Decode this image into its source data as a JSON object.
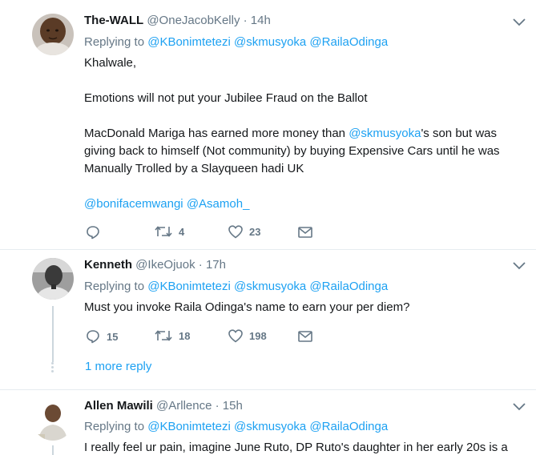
{
  "tweets": [
    {
      "name": "The-WALL",
      "handle": "@OneJacobKelly",
      "sep": "·",
      "time": "14h",
      "replying_prefix": "Replying to",
      "replying_to": [
        "@KBonimtetezi",
        "@skmusyoka",
        "@RailaOdinga"
      ],
      "lines": {
        "l1": "Khalwale,",
        "l2": "Emotions will not put your Jubilee Fraud on the Ballot",
        "l3a": "MacDonald Mariga has earned more money than ",
        "l3_mention": "@skmusyoka",
        "l3b": "'s son but was",
        "l4": "giving back to himself (Not community) by buying Expensive Cars until he was",
        "l5": "Manually Trolled by a Slayqueen hadi UK",
        "mention1": "@bonifacemwangi",
        "mention2": "@Asamoh_"
      },
      "replies": "",
      "retweets": "4",
      "likes": "23"
    },
    {
      "name": "Kenneth",
      "handle": "@IkeOjuok",
      "sep": "·",
      "time": "17h",
      "replying_prefix": "Replying to",
      "replying_to": [
        "@KBonimtetezi",
        "@skmusyoka",
        "@RailaOdinga"
      ],
      "text": "Must you invoke  Raila Odinga's name to earn your per diem?",
      "replies": "15",
      "retweets": "18",
      "likes": "198",
      "more_replies": "1 more reply"
    },
    {
      "name": "Allen Mawili",
      "handle": "@Arllence",
      "sep": "·",
      "time": "15h",
      "replying_prefix": "Replying to",
      "replying_to": [
        "@KBonimtetezi",
        "@skmusyoka",
        "@RailaOdinga"
      ],
      "text": "I really feel ur pain, imagine June Ruto, DP Ruto's daughter in her early 20s is a"
    }
  ],
  "colors": {
    "link": "#1da1f2",
    "muted": "#657786",
    "text": "#14171a",
    "border": "#e6ecf0"
  },
  "icons": [
    "reply-icon",
    "retweet-icon",
    "like-icon",
    "dm-icon",
    "chevron-down-icon"
  ]
}
